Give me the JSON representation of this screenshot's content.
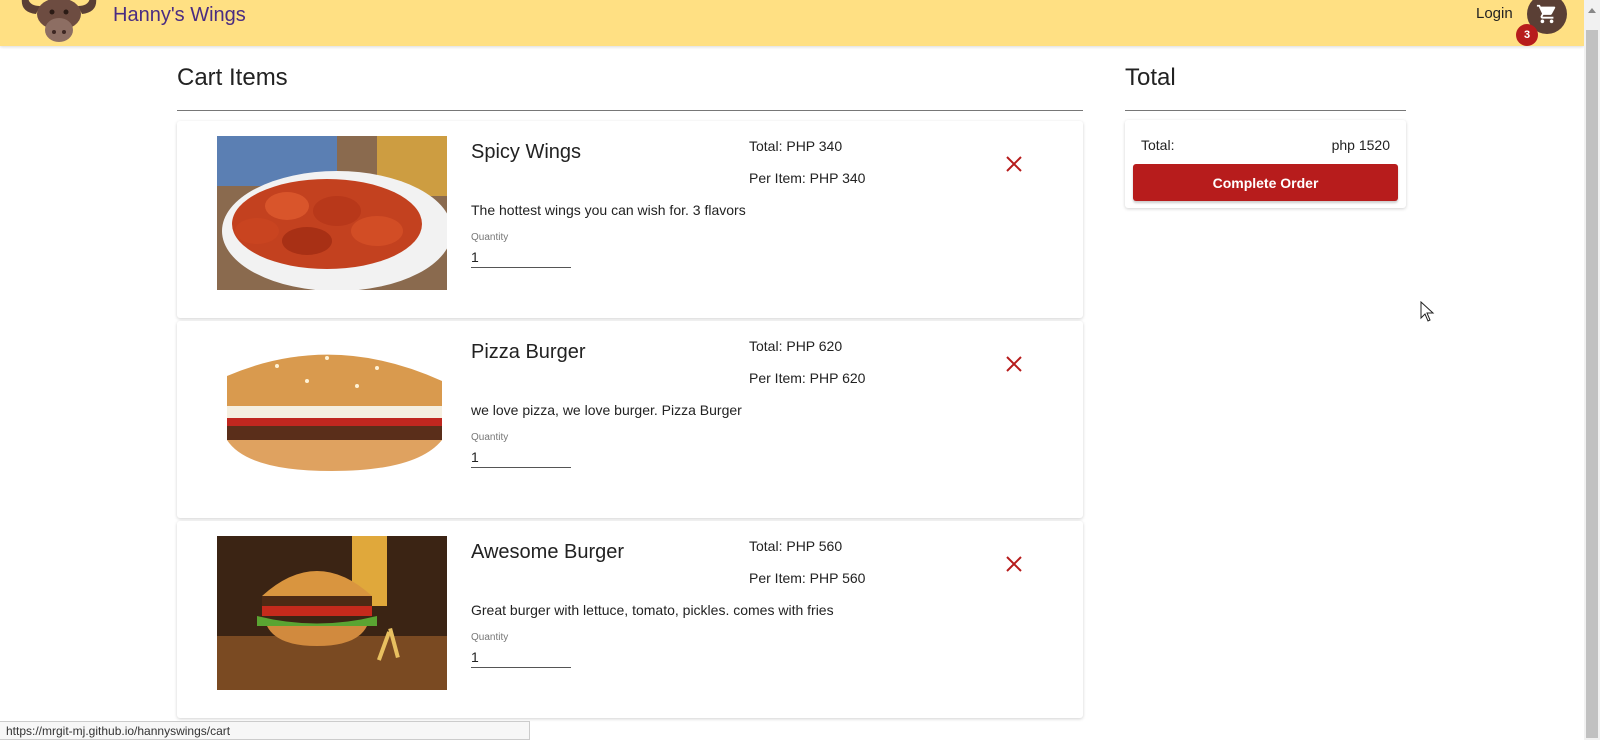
{
  "header": {
    "brand": "Hanny's Wings",
    "login_label": "Login",
    "cart_count": "3",
    "logo_icon": "bull-logo-icon",
    "cart_icon": "shopping-cart-icon"
  },
  "cart": {
    "title": "Cart Items",
    "items": [
      {
        "name": "Spicy Wings",
        "total": "Total: PHP 340",
        "per_item": "Per Item: PHP 340",
        "description": "The hottest wings you can wish for. 3 flavors",
        "quantity_label": "Quantity",
        "quantity": "1"
      },
      {
        "name": "Pizza Burger",
        "total": "Total: PHP 620",
        "per_item": "Per Item: PHP 620",
        "description": "we love pizza, we love burger. Pizza Burger",
        "quantity_label": "Quantity",
        "quantity": "1"
      },
      {
        "name": "Awesome Burger",
        "total": "Total: PHP 560",
        "per_item": "Per Item: PHP 560",
        "description": "Great burger with lettuce, tomato, pickles. comes with fries",
        "quantity_label": "Quantity",
        "quantity": "1"
      }
    ]
  },
  "summary": {
    "title": "Total",
    "total_label": "Total:",
    "total_value": "php 1520",
    "complete_label": "Complete Order"
  },
  "statusbar": {
    "url": "https://mrgit-mj.github.io/hannyswings/cart"
  },
  "colors": {
    "header_bg": "#ffe083",
    "brand": "#4a2c82",
    "accent_red": "#b71c1c",
    "cart_button": "#5a3f35"
  }
}
